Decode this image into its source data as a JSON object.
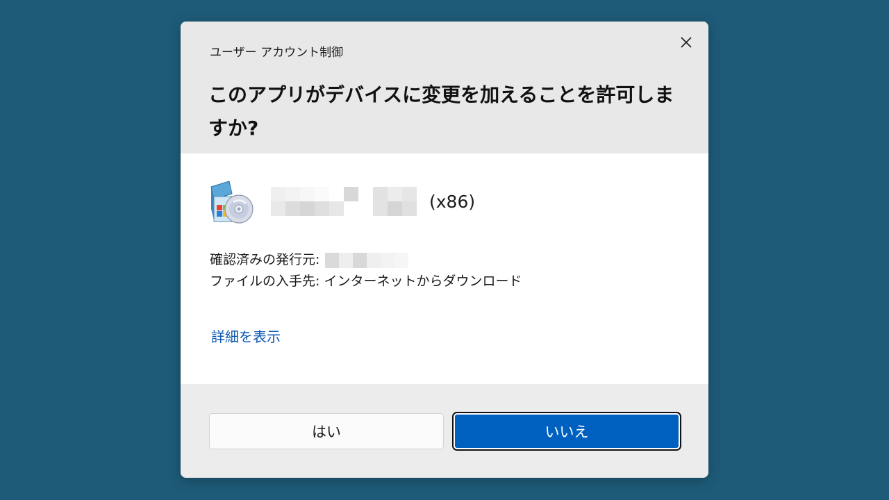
{
  "dialog": {
    "window_title": "ユーザー アカウント制御",
    "question": "このアプリがデバイスに変更を加えることを許可しますか?",
    "app": {
      "icon": "installer-cd-icon",
      "name_suffix": "(x86)"
    },
    "publisher_label": "確認済みの発行元:",
    "origin_line": "ファイルの入手先: インターネットからダウンロード",
    "details_link": "詳細を表示",
    "buttons": {
      "yes": "はい",
      "no": "いいえ"
    }
  },
  "colors": {
    "background": "#1e5b78",
    "header": "#e8e8e8",
    "footer": "#ececec",
    "primary_button": "#0060c0",
    "link": "#0a57b4"
  }
}
